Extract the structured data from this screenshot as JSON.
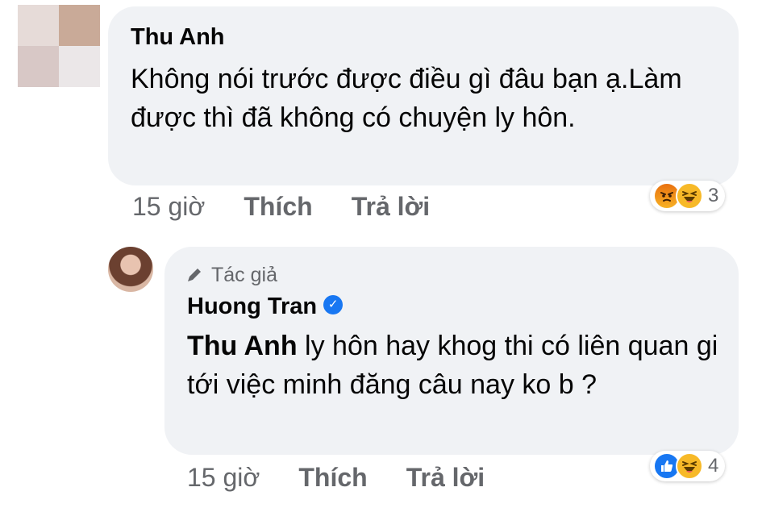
{
  "comment": {
    "author": "Thu Anh",
    "text": "Không nói trước được điều gì đâu bạn ạ.Làm được thì đã không có chuyện ly hôn.",
    "time": "15 giờ",
    "like_label": "Thích",
    "reply_label": "Trả lời",
    "reactions": {
      "icons": [
        "angry-icon",
        "haha-icon"
      ],
      "count": "3"
    }
  },
  "reply": {
    "badge": "Tác giả",
    "author": "Huong Tran",
    "mention": "Thu Anh",
    "text": " ly hôn hay khog thi có liên quan gi tới việc minh đăng câu nay ko b ?",
    "time": "15 giờ",
    "like_label": "Thích",
    "reply_label": "Trả lời",
    "reactions": {
      "icons": [
        "like-icon",
        "haha-icon"
      ],
      "count": "4"
    }
  }
}
